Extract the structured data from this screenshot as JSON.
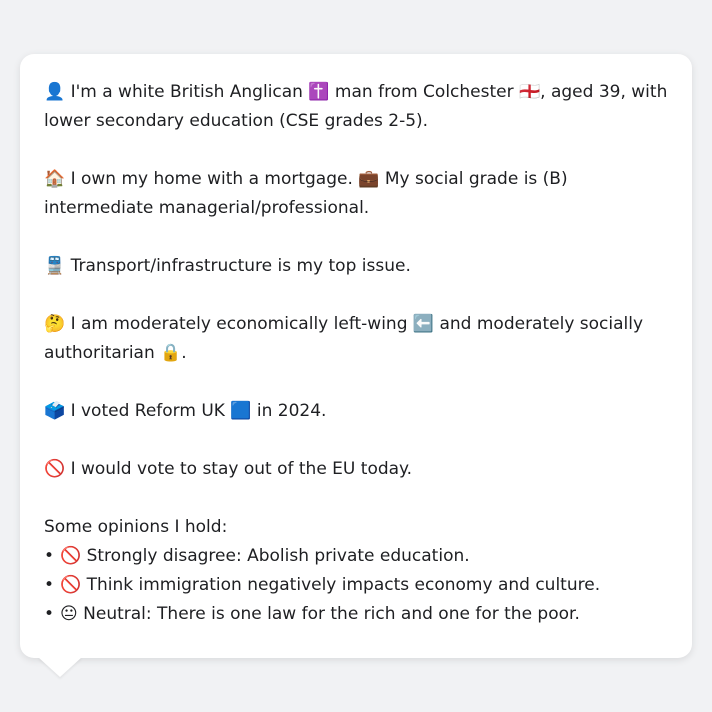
{
  "message": {
    "paragraphs": [
      "👤 I'm a white British Anglican ✝️ man from Colchester 🏴󠁧󠁢󠁥󠁮󠁧󠁿, aged 39, with lower secondary education (CSE grades 2-5).",
      "🏠 I own my home with a mortgage. 💼 My social grade is (B) intermediate managerial/professional.",
      "🚆 Transport/infrastructure is my top issue.",
      "🤔 I am moderately economically left-wing ⬅️ and moderately socially authoritarian 🔒.",
      "🗳️ I voted Reform UK 🟦 in 2024.",
      "🚫 I would vote to stay out of the EU today."
    ],
    "opinions_heading": "Some opinions I hold:",
    "opinions": [
      "🚫 Strongly disagree: Abolish private education.",
      "🚫 Think immigration negatively impacts economy and culture.",
      "😐 Neutral: There is one law for the rich and one for the poor."
    ],
    "bullet": "•"
  }
}
